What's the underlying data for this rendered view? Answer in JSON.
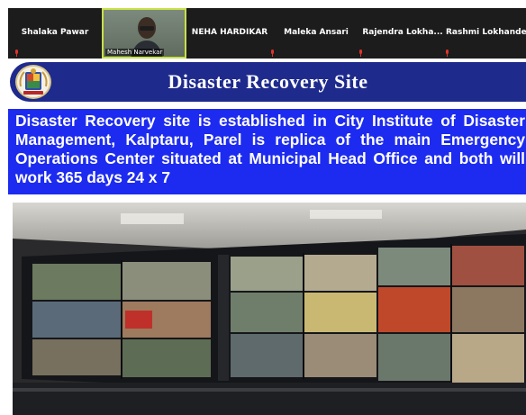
{
  "participants": [
    {
      "name": "Shalaka Pawar",
      "video": false
    },
    {
      "name": "Mahesh Narvekar",
      "video": true
    },
    {
      "name": "NEHA HARDIKAR",
      "video": false
    },
    {
      "name": "Maleka Ansari",
      "video": false
    },
    {
      "name": "Rajendra  Lokha...",
      "video": false
    },
    {
      "name": "Rashmi Lokhande",
      "video": false
    }
  ],
  "slide": {
    "title": "Disaster Recovery Site",
    "body": "Disaster Recovery site is established in City Institute of Disaster Management, Kalptaru, Parel is replica of the main Emergency Operations Center situated at Municipal Head Office and both will work 365 days 24 x 7",
    "logo_icon": "municipal-emblem-icon",
    "photo": "control-room-video-wall-photo"
  },
  "colors": {
    "strip": "#1c1c1c",
    "title_bar": "#1e2a8c",
    "body_box": "#1d2bf0",
    "mic_muted": "#e0342a",
    "active_speaker_border": "#c8e04a"
  }
}
